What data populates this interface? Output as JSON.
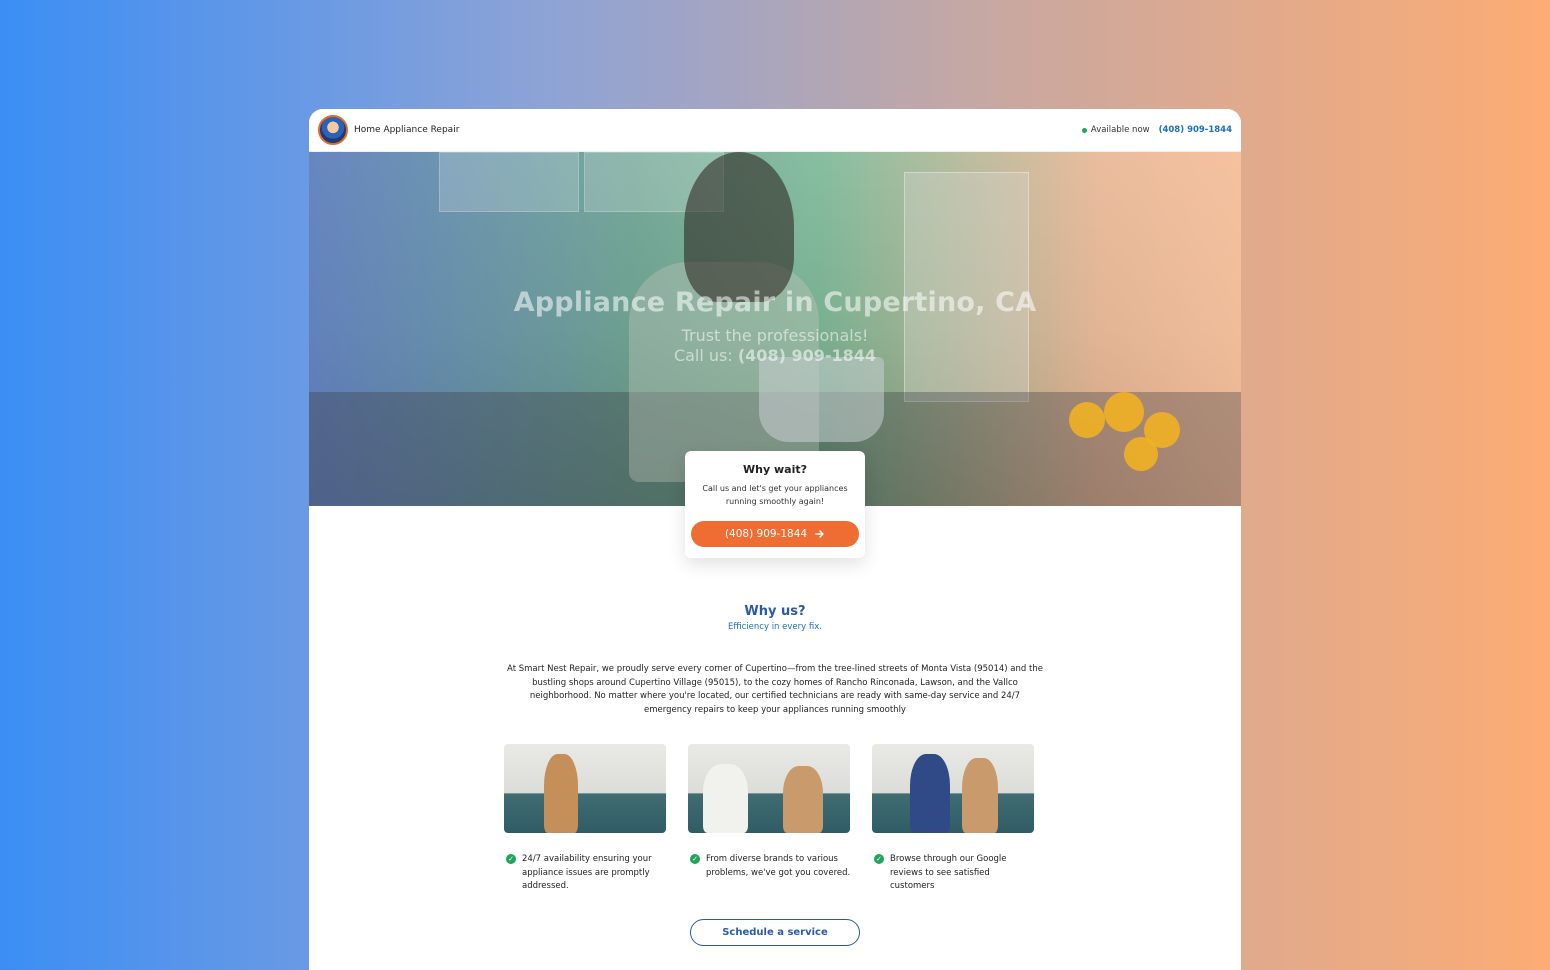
{
  "nav": {
    "brand": "Home Appliance Repair",
    "availability": "Available now",
    "phone": "(408) 909-1844"
  },
  "hero": {
    "title": "Appliance Repair in Cupertino, CA",
    "subtitle": "Trust the professionals!",
    "call_prefix": "Call us: ",
    "call_phone": "(408) 909-1844"
  },
  "card": {
    "title": "Why wait?",
    "text": "Call us and let's get your appliances running smoothly again!",
    "cta_label": "(408) 909-1844",
    "cta_icon": "arrow-right-icon"
  },
  "why": {
    "title": "Why us?",
    "subtitle": "Efficiency in every fix.",
    "text": "At Smart Nest Repair, we proudly serve every corner of Cupertino—from the tree-lined streets of Monta Vista (95014) and the bustling shops around Cupertino Village (95015), to the cozy homes of Rancho Rinconada, Lawson, and the Vallco neighborhood. No matter where you're located, our certified technicians are ready with same-day service and 24/7 emergency repairs to keep your appliances running smoothly"
  },
  "features": [
    {
      "text": "24/7 availability ensuring your appliance issues are promptly addressed."
    },
    {
      "text": "From diverse brands to various problems, we've got you covered."
    },
    {
      "text": "Browse through our Google reviews to see satisfied customers"
    }
  ],
  "schedule_label": "Schedule a service",
  "colors": {
    "accent_orange": "#ef6c33",
    "brand_blue": "#2a5aa8",
    "available_green": "#21a45b"
  }
}
